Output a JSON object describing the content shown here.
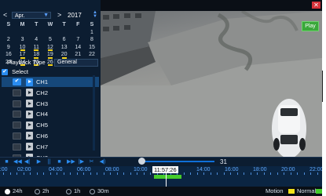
{
  "window": {
    "close_label": "✕"
  },
  "calendar": {
    "prev": "<",
    "next": ">",
    "month": "Apr.",
    "year": "2017",
    "weekdays": [
      "S",
      "M",
      "T",
      "W",
      "T",
      "F",
      "S"
    ],
    "weeks": [
      [
        "",
        "",
        "",
        "",
        "",
        "",
        "1"
      ],
      [
        "2",
        "3",
        "4",
        "5",
        "6",
        "7",
        "8"
      ],
      [
        "9",
        "10",
        "11",
        "12",
        "13",
        "14",
        "15"
      ],
      [
        "16",
        "17",
        "18",
        "19",
        "20",
        "21",
        "22"
      ],
      [
        "23",
        "24",
        "25",
        "26",
        "27",
        "28",
        "29"
      ]
    ],
    "selected_day": "27",
    "record_days": [
      "10",
      "11",
      "12",
      "17",
      "18",
      "19",
      "20",
      "24",
      "25",
      "26",
      "27"
    ]
  },
  "playback_type": {
    "label": "Playback Type",
    "value": "General"
  },
  "select_all": {
    "label": "Select",
    "checked": true
  },
  "channels": [
    {
      "name": "CH1",
      "checked": true,
      "selected": true
    },
    {
      "name": "CH2",
      "checked": false,
      "selected": false
    },
    {
      "name": "CH3",
      "checked": false,
      "selected": false
    },
    {
      "name": "CH4",
      "checked": false,
      "selected": false
    },
    {
      "name": "CH5",
      "checked": false,
      "selected": false
    },
    {
      "name": "CH6",
      "checked": false,
      "selected": false
    },
    {
      "name": "CH7",
      "checked": false,
      "selected": false
    },
    {
      "name": "CH8",
      "checked": false,
      "selected": false
    }
  ],
  "video": {
    "play_label": "Play"
  },
  "toolbar": {
    "icons": [
      "stop-icon",
      "rewind-icon",
      "slow-backward-icon",
      "play-icon",
      "pause-icon",
      "stop-square-icon",
      "fast-forward-icon",
      "frame-step-icon",
      "scissors-icon",
      "volume-icon"
    ],
    "glyphs": [
      "■",
      "◀◀",
      "◀|",
      "▶",
      "||",
      "■",
      "▶▶",
      "|▶",
      "✂",
      "◀)"
    ],
    "speed_value": "31",
    "volume_level": 0.1
  },
  "timeline": {
    "labels": [
      "00:00",
      "02:00",
      "04:00",
      "06:00",
      "08:00",
      "10:00",
      "14:00",
      "16:00",
      "18:00",
      "20:00",
      "22:00"
    ],
    "current_time": "11:57:26"
  },
  "zoom_options": [
    {
      "label": "24h",
      "selected": true
    },
    {
      "label": "2h",
      "selected": false
    },
    {
      "label": "1h",
      "selected": false
    },
    {
      "label": "30m",
      "selected": false
    }
  ],
  "legend": [
    {
      "label": "Motion",
      "color": "#f3e21a"
    },
    {
      "label": "Normal",
      "color": "#45cc2b"
    }
  ],
  "colors": {
    "accent": "#2a8cf0",
    "panel": "#0c1d31",
    "selected_day": "#f3d21a"
  }
}
